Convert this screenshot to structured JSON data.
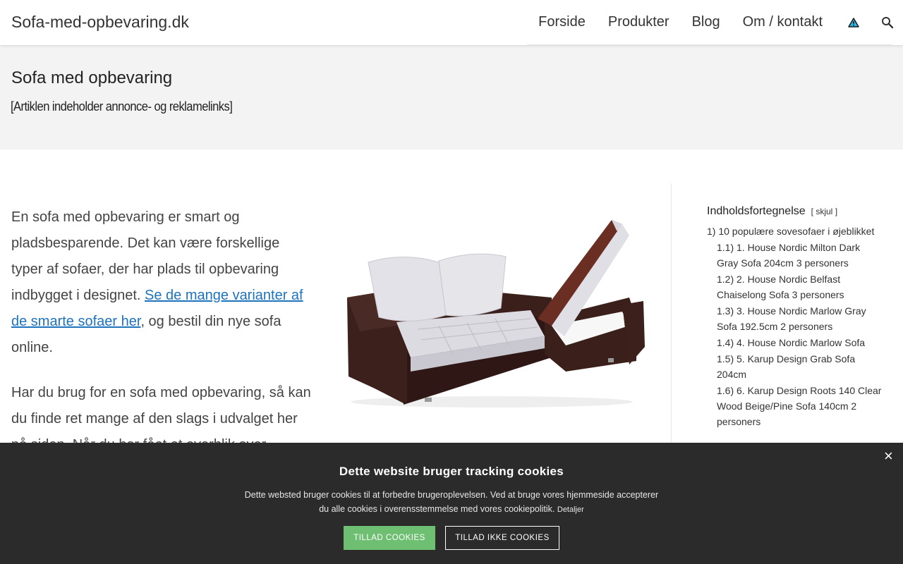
{
  "header": {
    "site_title": "Sofa-med-opbevaring.dk",
    "nav": [
      {
        "label": "Forside"
      },
      {
        "label": "Produkter"
      },
      {
        "label": "Blog"
      },
      {
        "label": "Om / kontakt"
      }
    ],
    "icons": [
      "warning-triangle-icon",
      "search-icon"
    ]
  },
  "title_band": {
    "title": "Sofa med opbevaring",
    "disclaimer": "[Artiklen indeholder annonce- og reklamelinks]"
  },
  "article": {
    "p1_before": "En sofa med opbevaring er smart og pladsbesparende. Det kan være forskellige typer af sofaer, der har plads til opbevaring indbygget i designet. ",
    "p1_link": "Se de mange varianter af de smarte sofaer her",
    "p1_after": ", og bestil din nye sofa online.",
    "p2": "Har du brug for en sofa med opbevaring, så kan du finde ret mange af den slags i udvalget her på siden. Når du har fået et overblik over",
    "image_alt": "sofa-with-storage-image"
  },
  "toc": {
    "heading": "Indholdsfortegnelse",
    "toggle_open": "[",
    "toggle_label": "skjul",
    "toggle_close": "]",
    "items": [
      {
        "num": "1)",
        "text": "10 populære sovesofaer i øjeblikket"
      },
      {
        "num": "1.1)",
        "text": "1. House Nordic Milton Dark Gray Sofa 204cm 3 personers"
      },
      {
        "num": "1.2)",
        "text": "2. House Nordic Belfast Chaiselong Sofa 3 personers"
      },
      {
        "num": "1.3)",
        "text": "3. House Nordic Marlow Gray Sofa 192.5cm 2 personers"
      },
      {
        "num": "1.4)",
        "text": "4. House Nordic Marlow Sofa"
      },
      {
        "num": "1.5)",
        "text": "5. Karup Design Grab Sofa 204cm"
      },
      {
        "num": "1.6)",
        "text": "6. Karup Design Roots 140 Clear Wood Beige/Pine Sofa 140cm 2 personers"
      }
    ]
  },
  "cookie": {
    "title": "Dette website bruger tracking cookies",
    "text": "Dette websted bruger cookies til at forbedre brugeroplevelsen. Ved at bruge vores hjemmeside accepterer du alle cookies i overensstemmelse med vores cookiepolitik.",
    "details": "Detaljer",
    "allow": "TILLAD COOKIES",
    "deny": "TILLAD IKKE COOKIES",
    "close": "×"
  },
  "colors": {
    "link": "#1e73be",
    "cookie_bg": "#2b2b2b",
    "allow_btn": "#6fbf73",
    "title_band": "#f3f3f3"
  }
}
